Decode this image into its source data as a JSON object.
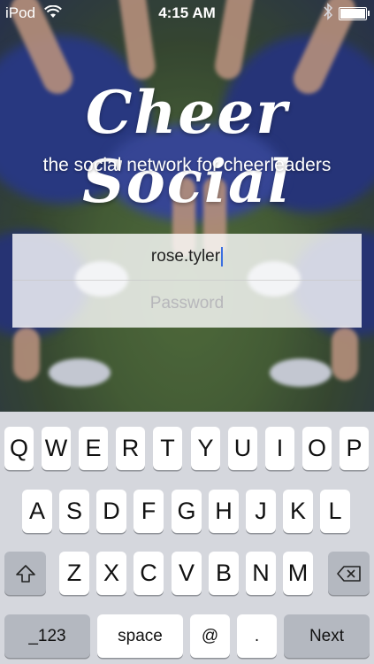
{
  "status_bar": {
    "carrier": "iPod",
    "time": "4:15 AM",
    "battery_level": 1.0,
    "icons": [
      "wifi-icon",
      "bluetooth-icon",
      "battery-icon"
    ]
  },
  "app": {
    "title": "Cheer Social",
    "tagline": "the social network for cheerleaders"
  },
  "login": {
    "username_value": "rose.tyler",
    "password_placeholder": "Password"
  },
  "keyboard": {
    "row1": [
      "Q",
      "W",
      "E",
      "R",
      "T",
      "Y",
      "U",
      "I",
      "O",
      "P"
    ],
    "row2": [
      "A",
      "S",
      "D",
      "F",
      "G",
      "H",
      "J",
      "K",
      "L"
    ],
    "row3": [
      "Z",
      "X",
      "C",
      "V",
      "B",
      "N",
      "M"
    ],
    "mode_key": "_123",
    "space_key": "space",
    "at_key": "@",
    "dot_key": ".",
    "return_key": "Next",
    "shift_icon": "shift-icon",
    "delete_icon": "delete-icon"
  },
  "colors": {
    "accent": "#3a6fe0",
    "key_bg": "#ffffff",
    "keyboard_bg": "#d5d7dd"
  }
}
